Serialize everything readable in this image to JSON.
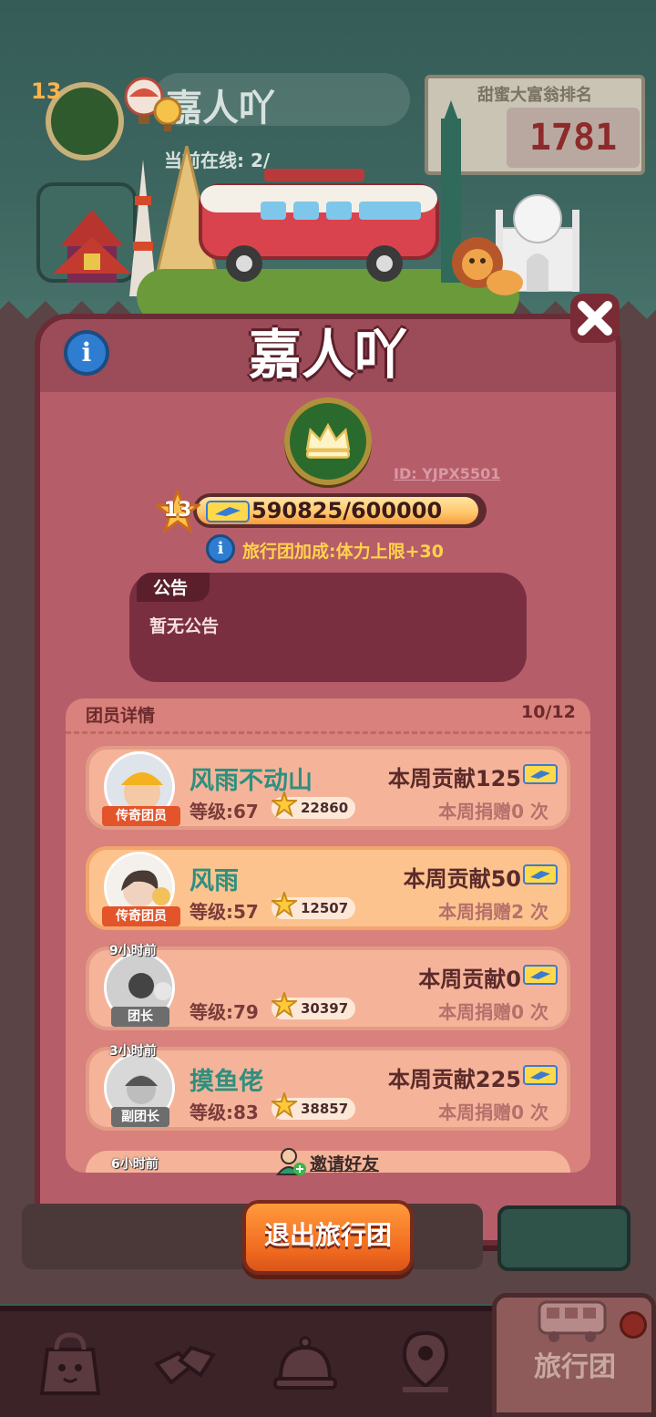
{
  "background": {
    "team_name": "嘉人吖",
    "online_label": "当前在线: 2/",
    "level": "13",
    "rank_board": {
      "title": "甜蜜大富翁排名",
      "value": "1781"
    }
  },
  "modal": {
    "title": "嘉人吖",
    "team_id": "ID: YJPX5501",
    "level": "13",
    "progress_text": "590825/600000",
    "progress_fraction": 0.9847,
    "bonus_text": "旅行团加成:体力上限+30",
    "notice": {
      "label": "公告",
      "text": "暂无公告"
    },
    "members": {
      "title": "团员详情",
      "count": "10/12",
      "list": [
        {
          "time_ago": "",
          "name": "风雨不动山",
          "role": "传奇团员",
          "level": "等级:67",
          "score": "22860",
          "contribution": "本周贡献125",
          "donations": "本周捐赠0 次",
          "highlight": false,
          "online": true
        },
        {
          "time_ago": "",
          "name": "风雨",
          "role": "传奇团员",
          "level": "等级:57",
          "score": "12507",
          "contribution": "本周贡献50",
          "donations": "本周捐赠2 次",
          "highlight": true,
          "online": true
        },
        {
          "time_ago": "9小时前",
          "name": "",
          "role": "团长",
          "level": "等级:79",
          "score": "30397",
          "contribution": "本周贡献0",
          "donations": "本周捐赠0 次",
          "highlight": false,
          "online": false
        },
        {
          "time_ago": "3小时前",
          "name": "摸鱼佬",
          "role": "副团长",
          "level": "等级:83",
          "score": "38857",
          "contribution": "本周贡献225",
          "donations": "本周捐赠0 次",
          "highlight": false,
          "online": false
        }
      ],
      "partial_time_ago": "6小时前"
    },
    "invite_label": "邀请好友",
    "quit_label": "退出旅行团"
  },
  "bottom_nav": {
    "items": [
      {
        "icon": "shop-bag-icon"
      },
      {
        "icon": "trade-icon"
      },
      {
        "icon": "service-bell-icon"
      },
      {
        "icon": "map-pin-icon"
      }
    ],
    "active_label": "旅行团"
  },
  "colors": {
    "modal_bg": "#9c4b58",
    "card_bg": "#f5b49a",
    "member_name": "#2f8f7f",
    "quit_button": "#f06a1f"
  }
}
